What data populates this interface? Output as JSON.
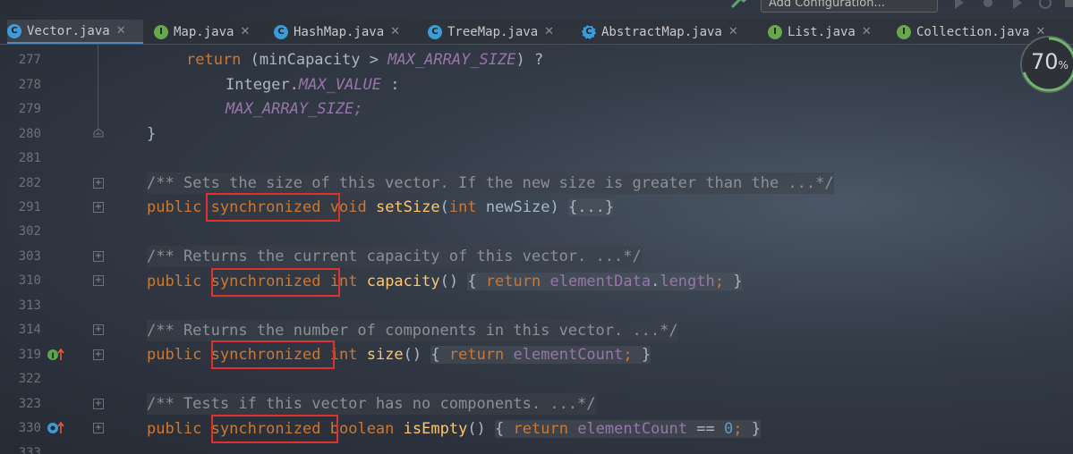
{
  "toolbar": {
    "run_config_label": "Add Configuration..."
  },
  "tabs": [
    {
      "label": "Vector.java",
      "kind": "class",
      "letter": "C",
      "active": true,
      "closable": true
    },
    {
      "label": "Map.java",
      "kind": "interface",
      "letter": "I",
      "active": false,
      "closable": true
    },
    {
      "label": "HashMap.java",
      "kind": "class",
      "letter": "C",
      "active": false,
      "closable": true
    },
    {
      "label": "TreeMap.java",
      "kind": "class",
      "letter": "C",
      "active": false,
      "closable": true
    },
    {
      "label": "AbstractMap.java",
      "kind": "abstract-class",
      "letter": "C",
      "active": false,
      "closable": true
    },
    {
      "label": "List.java",
      "kind": "interface",
      "letter": "I",
      "active": false,
      "closable": true
    },
    {
      "label": "Collection.java",
      "kind": "interface",
      "letter": "I",
      "active": false,
      "closable": true
    }
  ],
  "gutter": {
    "line_numbers": [
      "277",
      "278",
      "279",
      "280",
      "281",
      "282",
      "291",
      "302",
      "303",
      "310",
      "313",
      "314",
      "319",
      "322",
      "323",
      "330",
      "333"
    ]
  },
  "code": {
    "l277": {
      "kw": "return",
      "rest": " (minCapacity > ",
      "konst": "MAX_ARRAY_SIZE",
      "tail": ") ?"
    },
    "l278": {
      "plain": "Integer.",
      "konst": "MAX_VALUE",
      "tail": " :"
    },
    "l279": {
      "konst": "MAX_ARRAY_SIZE",
      "tail": ";"
    },
    "l280": {
      "plain": "}"
    },
    "l282": {
      "comment": "/** Sets the size of this vector. If the new size is greater than the ...*/"
    },
    "l291": {
      "kw1": "public",
      "kw2": "synchronized",
      "kw3": "void",
      "method": "setSize",
      "open": "(",
      "kw4": "int",
      "param": " newSize",
      "close": ") ",
      "folded": "{...}"
    },
    "l303": {
      "comment": "/** Returns the current capacity of this vector. ...*/"
    },
    "l310": {
      "kw1": "public",
      "kw2": "synchronized",
      "kw3": "int",
      "method": "capacity",
      "parens": "() ",
      "brace_open": "{ ",
      "kw_ret": "return",
      "field": "elementData",
      "dot": ".",
      "field2": "length",
      "semi": ";",
      "brace_close": " }"
    },
    "l314": {
      "comment": "/** Returns the number of components in this vector. ...*/"
    },
    "l319": {
      "kw1": "public",
      "kw2": "synchronized",
      "kw3": "int",
      "method": "size",
      "parens": "() ",
      "brace_open": "{ ",
      "kw_ret": "return",
      "field": "elementCount",
      "semi": ";",
      "brace_close": " }"
    },
    "l323": {
      "comment": "/** Tests if this vector has no components. ...*/"
    },
    "l330": {
      "kw1": "public",
      "kw2": "synchronized",
      "kw3": "boolean",
      "method": "isEmpty",
      "parens": "() ",
      "brace_open": "{ ",
      "kw_ret": "return",
      "field": "elementCount",
      "op": " == ",
      "num": "0",
      "semi": ";",
      "brace_close": " }"
    }
  },
  "progress": {
    "value": "70",
    "unit": "%",
    "fraction": 0.7
  },
  "colors": {
    "keyword": "#cc7832",
    "constant": "#9876aa",
    "method": "#ffc66d",
    "comment": "#8c9096",
    "number": "#6897bb",
    "highlight_box": "#e0322c",
    "active_tab_underline": "#4a88c7"
  }
}
